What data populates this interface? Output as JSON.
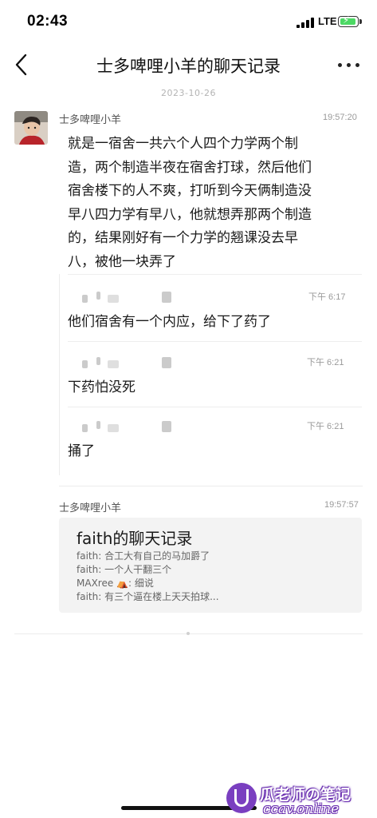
{
  "status_bar": {
    "time": "02:43",
    "network": "LTE"
  },
  "nav": {
    "title": "士多啤哩小羊的聊天记录"
  },
  "date_separator": "2023-10-26",
  "message1": {
    "sender": "士多啤哩小羊",
    "time": "19:57:20",
    "text_lines": [
      "就是一宿舍一共六个人四个力学两个制",
      "造，两个制造半夜在宿舍打球，然后他们",
      "宿舍楼下的人不爽，打听到今天俩制造没",
      "早八四力学有早八，他就想弄那两个制造",
      "的，结果刚好有一个力学的翘课没去早",
      "八，被他一块弄了"
    ],
    "quoted": [
      {
        "time": "下午 6:17",
        "text": "他们宿舍有一个内应，给下了药了"
      },
      {
        "time": "下午 6:21",
        "text": "下药怕没死"
      },
      {
        "time": "下午 6:21",
        "text": "捅了"
      }
    ]
  },
  "message2": {
    "sender": "士多啤哩小羊",
    "time": "19:57:57",
    "card": {
      "title": "faith的聊天记录",
      "lines": [
        "faith: 合工大有自己的马加爵了",
        "faith: 一个人干翻三个",
        "MAXree ⛺: 细说",
        "faith: 有三个逼在楼上天天拍球..."
      ]
    }
  },
  "watermark": {
    "line1": "瓜老师の笔记",
    "line2": "ccav.online"
  },
  "colors": {
    "battery": "#4cd964",
    "watermark": "#7a3fc0"
  }
}
